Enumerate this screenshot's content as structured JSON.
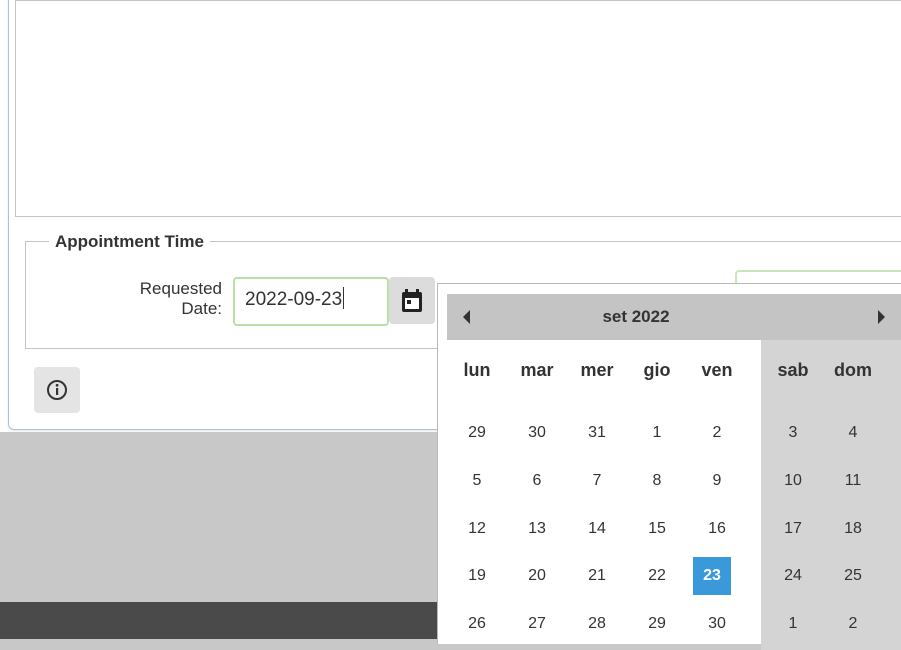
{
  "fieldset": {
    "legend": "Appointment Time"
  },
  "form": {
    "requested_date_label_line1": "Requested",
    "requested_date_label_line2": "Date:",
    "requested_date_value": "2022-09-23"
  },
  "icons": {
    "calendar": "calendar-icon",
    "info": "info-icon",
    "prev": "triangle-left-icon",
    "next": "triangle-right-icon"
  },
  "datepicker": {
    "month_title": "set 2022",
    "weekdays": [
      "lun",
      "mar",
      "mer",
      "gio",
      "ven",
      "sab",
      "dom"
    ],
    "weeks": [
      [
        "29",
        "30",
        "31",
        "1",
        "2",
        "3",
        "4"
      ],
      [
        "5",
        "6",
        "7",
        "8",
        "9",
        "10",
        "11"
      ],
      [
        "12",
        "13",
        "14",
        "15",
        "16",
        "17",
        "18"
      ],
      [
        "19",
        "20",
        "21",
        "22",
        "23",
        "24",
        "25"
      ],
      [
        "26",
        "27",
        "28",
        "29",
        "30",
        "1",
        "2"
      ]
    ],
    "selected_day": "23"
  },
  "colors": {
    "selected": "#3a9ad9",
    "input_border": "#b8e0a8",
    "header_bg": "#c4c4c4",
    "weekend_bg": "#d4d4d4"
  }
}
